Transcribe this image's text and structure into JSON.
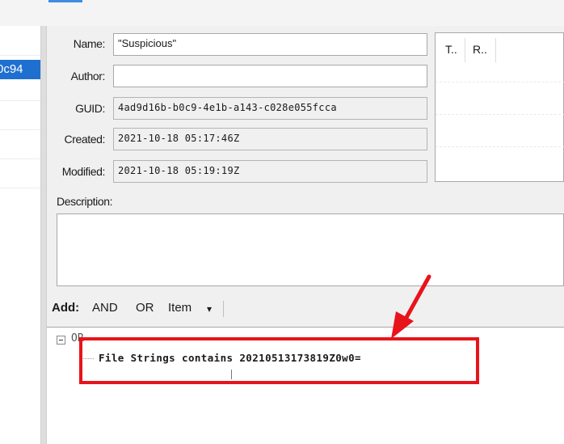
{
  "left_pane": {
    "selected_item_fragment": "0c94"
  },
  "form": {
    "name_label": "Name:",
    "name_value": "\"Suspicious\"",
    "author_label": "Author:",
    "author_value": "",
    "guid_label": "GUID:",
    "guid_value": "4ad9d16b-b0c9-4e1b-a143-c028e055fcca",
    "created_label": "Created:",
    "created_value": "2021-10-18 05:17:46Z",
    "modified_label": "Modified:",
    "modified_value": "2021-10-18 05:19:19Z",
    "description_label": "Description:",
    "description_value": ""
  },
  "columns": [
    "T..",
    "R.."
  ],
  "toolbar": {
    "add_label": "Add:",
    "and_label": "AND",
    "or_label": "OR",
    "item_label": "Item",
    "item_dropdown_glyph": "▾"
  },
  "tree": {
    "root_label": "OR",
    "item_label": "File Strings contains 20210513173819Z0w0="
  },
  "annotation": {
    "highlight_color": "#e8141b"
  }
}
